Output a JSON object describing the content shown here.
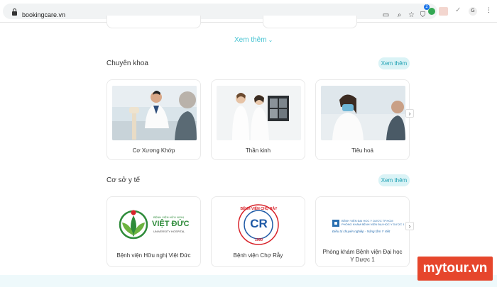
{
  "browser": {
    "url": "bookingcare.vn",
    "extension_badge": "2",
    "profile_initial": "G"
  },
  "page": {
    "see_more_link": "Xem thêm",
    "specialties": {
      "title": "Chuyên khoa",
      "see_more": "Xem thêm",
      "items": [
        {
          "label": "Cơ Xương Khớp"
        },
        {
          "label": "Thần kinh"
        },
        {
          "label": "Tiêu hoá"
        }
      ]
    },
    "facilities": {
      "title": "Cơ sở y tế",
      "see_more": "Xem thêm",
      "items": [
        {
          "label": "Bệnh viện Hữu nghị Việt Đức",
          "logo_top": "BỆNH VIỆN HỮU NGHỊ",
          "logo_main": "VIỆT ĐỨC",
          "logo_sub": "UNIVERSITY HOSPITAL"
        },
        {
          "label": "Bệnh viện Chợ Rẫy",
          "logo_ring": "BỆNH VIỆN CHỢ RẪY",
          "logo_year": "1900",
          "logo_letters": "CR"
        },
        {
          "label": "Phòng khám Bệnh viện Đại học Y Dược 1",
          "logo_line1": "BỆNH VIỆN ĐẠI HỌC Y DƯỢC TP.HCM",
          "logo_line2": "PHÒNG KHÁM BỆNH VIỆN ĐẠI HỌC Y DƯỢC 1",
          "logo_line3": "Điều trị chuyên nghiệp - Nâng tầm Y Việt"
        }
      ]
    }
  },
  "watermark": "mytour.vn",
  "colors": {
    "accent": "#45c3d2",
    "pill_bg": "#daf3f6",
    "watermark_bg": "#e6462c",
    "viet_duc_green": "#2e8b3a",
    "cho_ray_red": "#d8232a",
    "cho_ray_blue": "#1f5aa6",
    "umc_blue": "#2a6fb0"
  },
  "icons": [
    "lock-icon",
    "install-icon",
    "zoom-icon",
    "star-icon",
    "extension-icon",
    "download-icon",
    "chevron-down-icon",
    "chevron-right-icon",
    "menu-dots-icon"
  ]
}
